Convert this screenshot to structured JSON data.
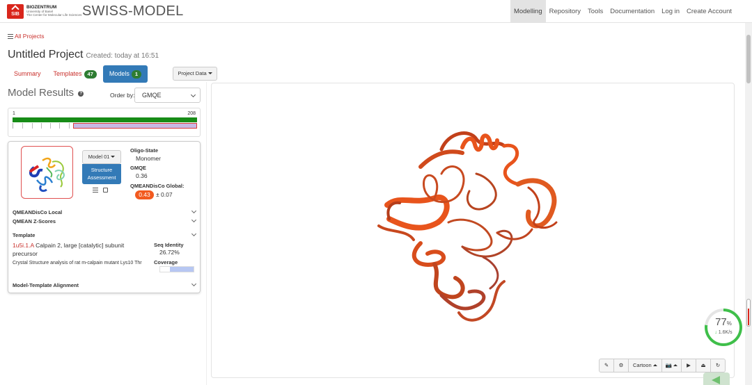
{
  "header": {
    "sib_logo_text": "SIB",
    "biozentrum_title": "BIOZENTRUM",
    "biozentrum_sub1": "University of Basel",
    "biozentrum_sub2": "The Center for Molecular Life Sciences",
    "brand": "SWISS-MODEL",
    "nav": [
      {
        "label": "Modelling",
        "active": true
      },
      {
        "label": "Repository"
      },
      {
        "label": "Tools"
      },
      {
        "label": "Documentation"
      },
      {
        "label": "Log in"
      },
      {
        "label": "Create Account"
      }
    ]
  },
  "breadcrumb": {
    "all_projects": "All Projects"
  },
  "project": {
    "title": "Untitled Project",
    "created": "Created: today at 16:51"
  },
  "tabs": [
    {
      "label": "Summary"
    },
    {
      "label": "Templates",
      "count": "47"
    },
    {
      "label": "Models",
      "count": "1",
      "active": true
    }
  ],
  "project_data_button": "Project Data",
  "results": {
    "title": "Model Results",
    "order_label": "Order by:",
    "order_value": "GMQE"
  },
  "coverage": {
    "start": "1",
    "end": "208",
    "hit_from_fraction": 0.33,
    "hit_to_fraction": 1.0
  },
  "model": {
    "model_button": "Model 01",
    "assess_line1": "Structure",
    "assess_line2": "Assessment",
    "oligo_label": "Oligo-State",
    "oligo_value": "Monomer",
    "gmqe_label": "GMQE",
    "gmqe_value": "0.36",
    "qmean_label": "QMEANDisCo Global:",
    "qmean_value": "0.43",
    "qmean_err": "± 0.07",
    "qmean_local": "QMEANDisCo Local",
    "qmean_z": "QMEAN Z-Scores",
    "template_label": "Template",
    "template_id": "1u5i.1.A",
    "template_name": "Calpain 2, large [catalytic] subunit precursor",
    "template_desc": "Crystal Structure analysis of rat m-calpain mutant Lys10 Thr",
    "seq_identity_label": "Seq Identity",
    "seq_identity_value": "26.72%",
    "coverage_label": "Coverage",
    "coverage_fraction": 0.7,
    "alignment_label": "Model-Template Alignment"
  },
  "viewer_toolbar": {
    "pencil": "✎",
    "gear": "⚙",
    "cartoon": "Cartoon",
    "camera": "📷",
    "play": "▶",
    "eject": "⏏",
    "refresh": "↻"
  },
  "speed": {
    "percent": "77",
    "percent_unit": "%",
    "rate": "1.6K/s",
    "fraction": 0.77
  },
  "colors": {
    "accent": "#337ab7",
    "link": "#c9302c",
    "badge_green": "#2e7d32",
    "qmean_orange": "#f25a1f",
    "ribbon": "#e8541c"
  }
}
